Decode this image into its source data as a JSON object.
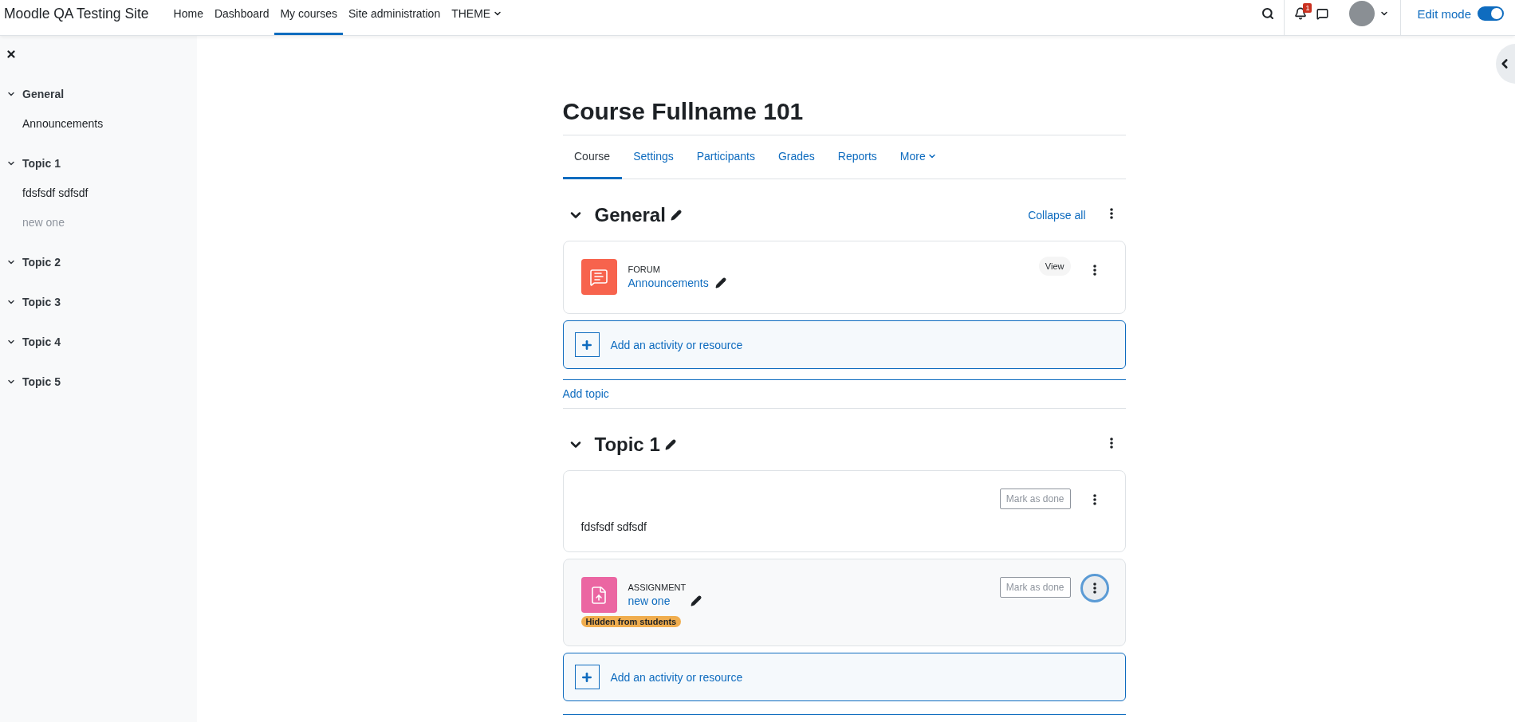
{
  "navbar": {
    "brand": "Moodle QA Testing Site",
    "links": [
      {
        "label": "Home",
        "selected": false,
        "dropdown": false
      },
      {
        "label": "Dashboard",
        "selected": false,
        "dropdown": false
      },
      {
        "label": "My courses",
        "selected": true,
        "dropdown": false
      },
      {
        "label": "Site administration",
        "selected": false,
        "dropdown": false
      },
      {
        "label": "THEME",
        "selected": false,
        "dropdown": true
      }
    ],
    "notification_count": "1",
    "edit_mode": {
      "label": "Edit mode",
      "on": true
    }
  },
  "sidebar": {
    "items": [
      {
        "label": "General",
        "expanded": true,
        "children": [
          {
            "label": "Announcements",
            "hidden": false
          }
        ]
      },
      {
        "label": "Topic 1",
        "expanded": true,
        "children": [
          {
            "label": "fdsfsdf sdfsdf",
            "hidden": false
          },
          {
            "label": "new one",
            "hidden": true
          }
        ]
      },
      {
        "label": "Topic 2",
        "expanded": true
      },
      {
        "label": "Topic 3",
        "expanded": true
      },
      {
        "label": "Topic 4",
        "expanded": true
      },
      {
        "label": "Topic 5",
        "expanded": true
      }
    ]
  },
  "course": {
    "title": "Course Fullname 101",
    "tabs": [
      {
        "label": "Course",
        "selected": true,
        "dropdown": false
      },
      {
        "label": "Settings",
        "selected": false,
        "dropdown": false
      },
      {
        "label": "Participants",
        "selected": false,
        "dropdown": false
      },
      {
        "label": "Grades",
        "selected": false,
        "dropdown": false
      },
      {
        "label": "Reports",
        "selected": false,
        "dropdown": false
      },
      {
        "label": "More",
        "selected": false,
        "dropdown": true
      }
    ],
    "sections": [
      {
        "title": "General",
        "expanded": true,
        "collapse_all": "Collapse all",
        "add_activity": "Add an activity or resource",
        "add_topic": "Add topic",
        "activities": [
          {
            "kind": "forum",
            "type": "FORUM",
            "name": "Announcements",
            "action": {
              "kind": "view",
              "label": "View"
            },
            "focused": false
          }
        ]
      },
      {
        "title": "Topic 1",
        "expanded": true,
        "add_activity": "Add an activity or resource",
        "activities": [
          {
            "kind": "label",
            "text": "fdsfsdf sdfsdf",
            "action": {
              "kind": "completion",
              "label": "Mark as done"
            },
            "focused": false
          },
          {
            "kind": "assignment",
            "type": "ASSIGNMENT",
            "name": "new one",
            "badge": "Hidden from students",
            "action": {
              "kind": "completion",
              "label": "Mark as done"
            },
            "focused": true
          }
        ]
      }
    ]
  }
}
